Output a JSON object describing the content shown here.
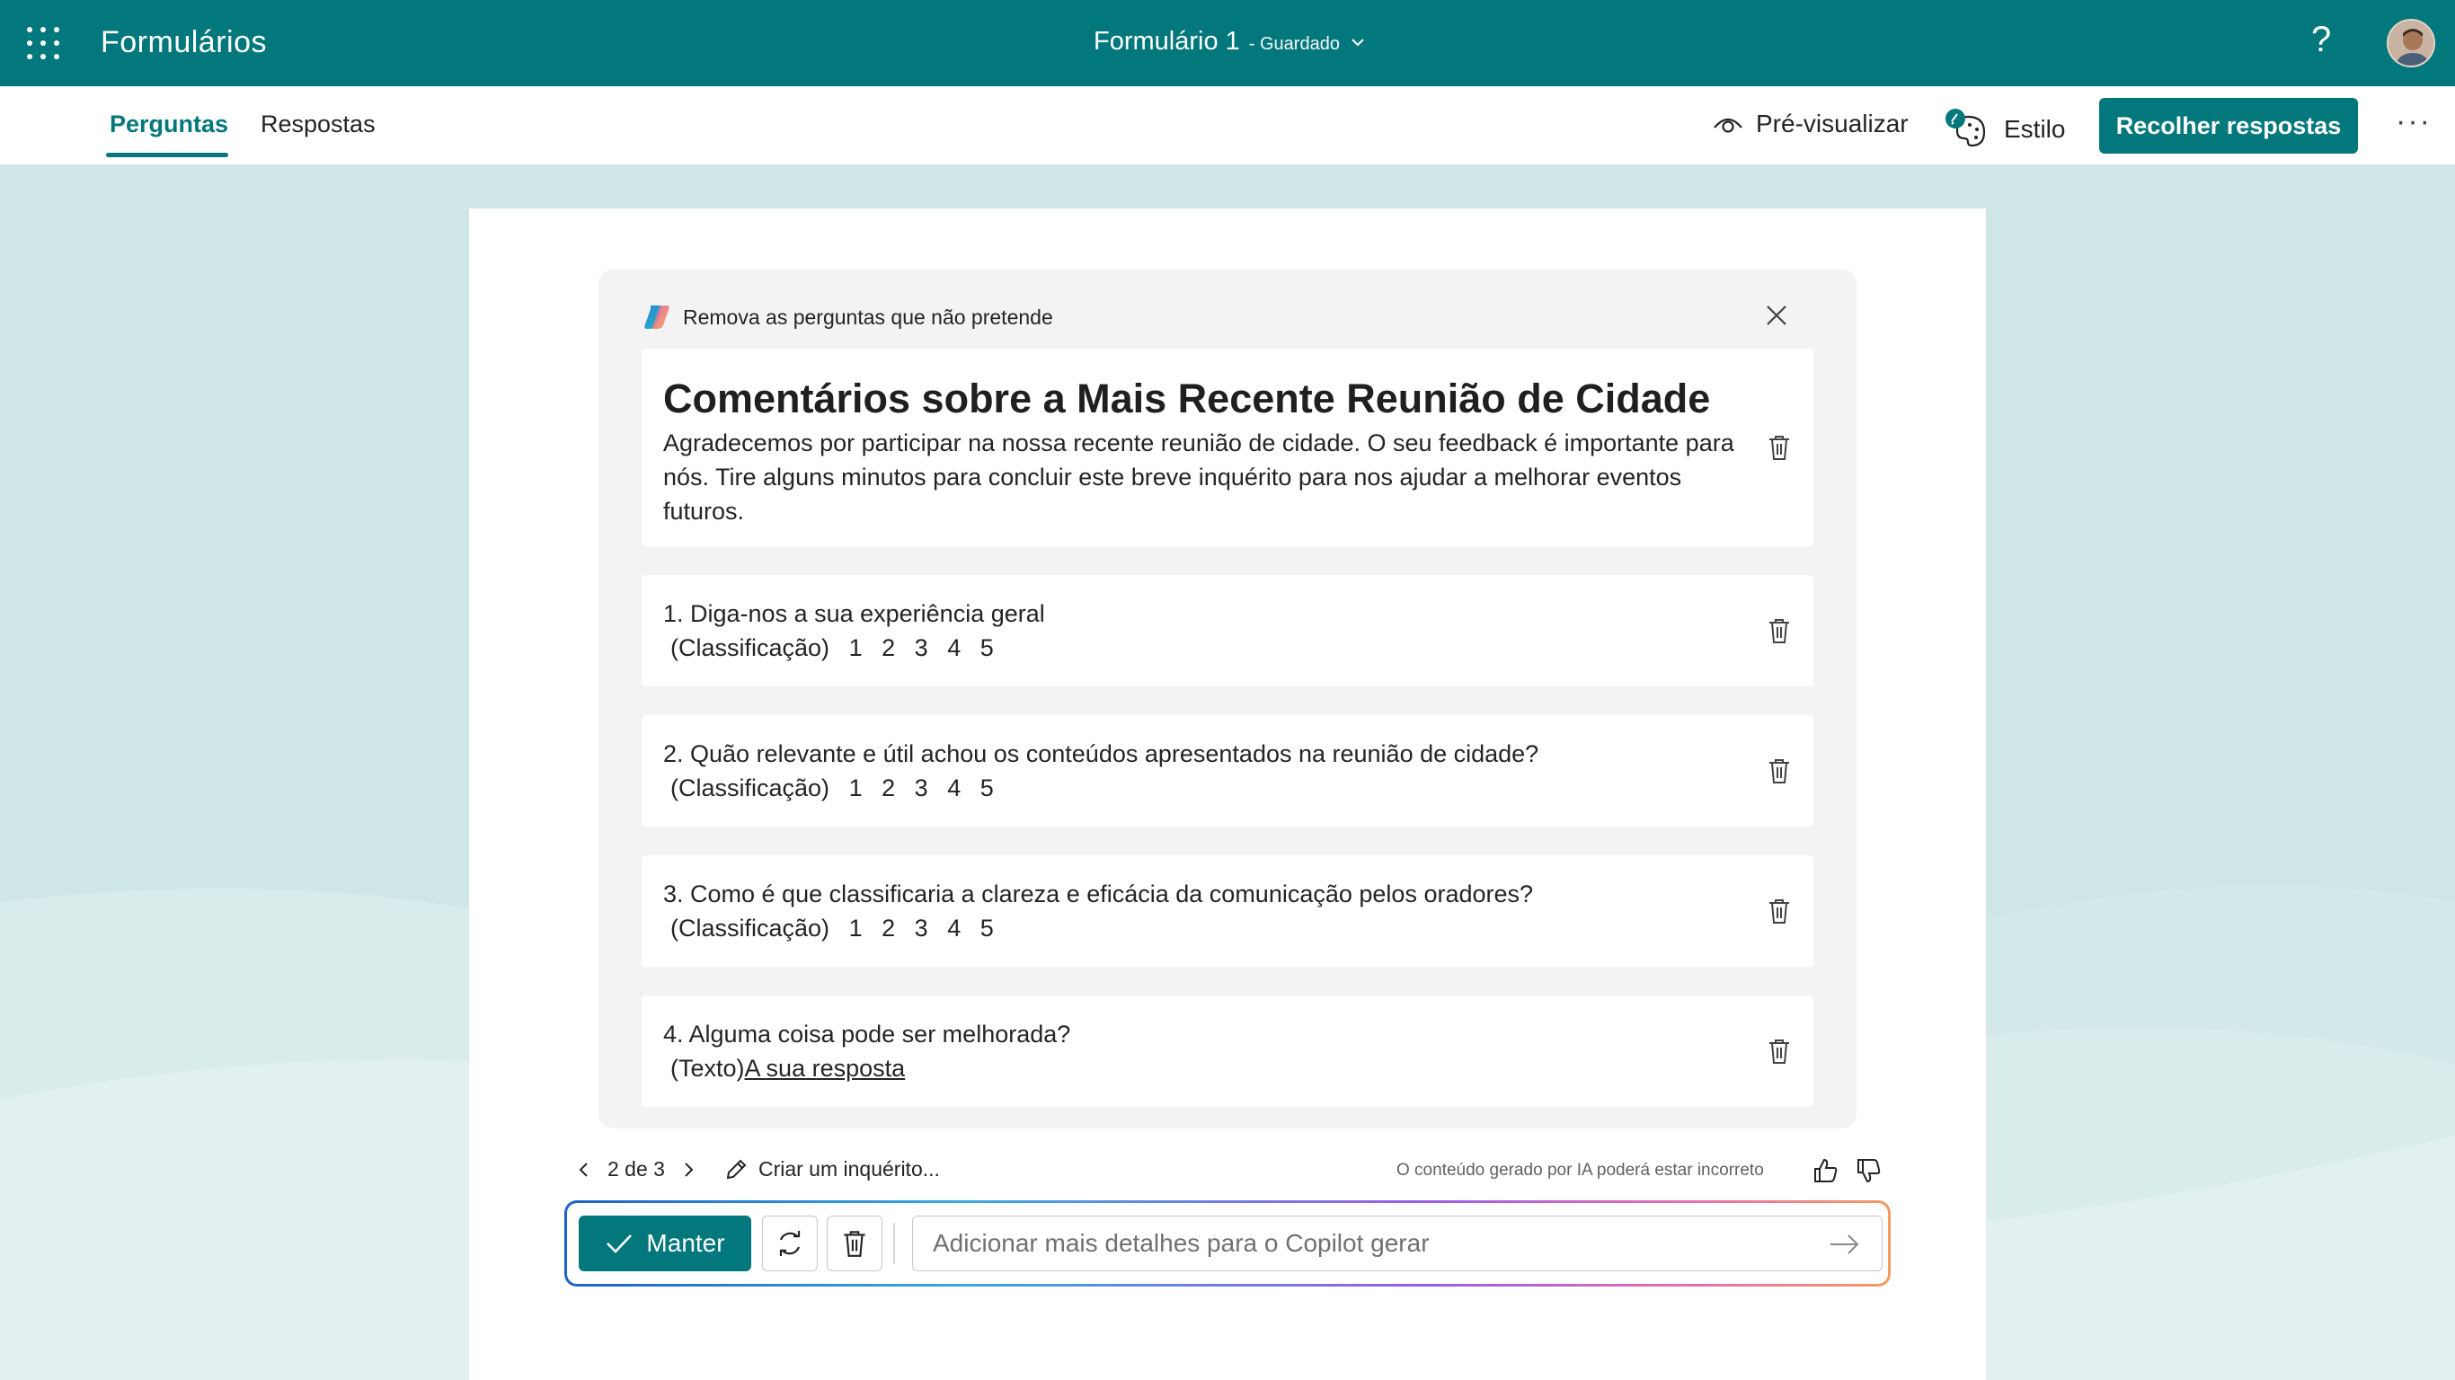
{
  "app": {
    "name": "Formulários"
  },
  "document": {
    "title": "Formulário 1",
    "status": "- Guardado"
  },
  "header": {
    "help_label": "?"
  },
  "tabs": [
    {
      "label": "Perguntas"
    },
    {
      "label": "Respostas"
    }
  ],
  "toolbar": {
    "preview_label": "Pré-visualizar",
    "style_label": "Estilo",
    "collect_label": "Recolher respostas",
    "more_label": "···"
  },
  "copilot": {
    "hint": "Remova as perguntas que não pretende",
    "form_title": "Comentários sobre a Mais Recente Reunião de Cidade",
    "form_description": "Agradecemos por participar na nossa recente reunião de cidade. O seu feedback é importante para nós. Tire alguns minutos para concluir este breve inquérito para nos ajudar a melhorar eventos futuros.",
    "questions": [
      {
        "text": "1. Diga-nos a sua experiência geral",
        "type": "(Classificação)",
        "options": [
          "1",
          "2",
          "3",
          "4",
          "5"
        ]
      },
      {
        "text": "2. Quão relevante e útil achou os conteúdos apresentados na reunião de cidade?",
        "type": "(Classificação)",
        "options": [
          "1",
          "2",
          "3",
          "4",
          "5"
        ]
      },
      {
        "text": "3. Como é que classificaria a clareza e eficácia da comunicação pelos oradores?",
        "type": "(Classificação)",
        "options": [
          "1",
          "2",
          "3",
          "4",
          "5"
        ]
      },
      {
        "text": "4. Alguma coisa pode ser melhorada?",
        "type": "(Texto)",
        "answer_placeholder": "A sua resposta"
      }
    ],
    "pager": {
      "label": "2 de 3"
    },
    "create_label": "Criar um inquérito...",
    "disclaimer": "O conteúdo gerado por IA poderá estar incorreto",
    "keep_label": "Manter",
    "input_placeholder": "Adicionar mais detalhes para o Copilot gerar"
  },
  "colors": {
    "brand": "#03787c",
    "background": "#cfe6e7"
  }
}
